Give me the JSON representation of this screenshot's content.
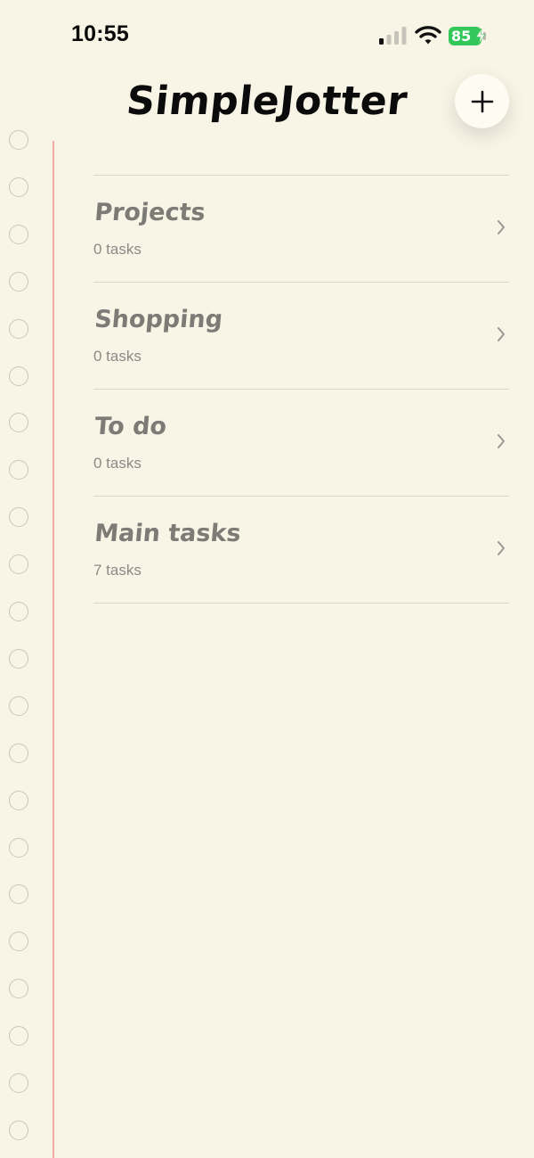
{
  "status_bar": {
    "time": "10:55",
    "battery_level": "85",
    "icons": [
      "signal-icon",
      "wifi-icon",
      "battery-icon",
      "charging-bolt-icon"
    ],
    "battery_color": "#34c759"
  },
  "header": {
    "title": "SimpleJotter",
    "add_icon": "plus-icon"
  },
  "lists": [
    {
      "name": "Projects",
      "count": "0 tasks"
    },
    {
      "name": "Shopping",
      "count": "0 tasks"
    },
    {
      "name": "To do",
      "count": "0 tasks"
    },
    {
      "name": "Main tasks",
      "count": "7 tasks"
    }
  ],
  "theme": {
    "paper": "#f8f4e6",
    "margin_line": "#f1aaa4",
    "title_color": "#0b0b0b",
    "list_text": "#7d7b76"
  }
}
